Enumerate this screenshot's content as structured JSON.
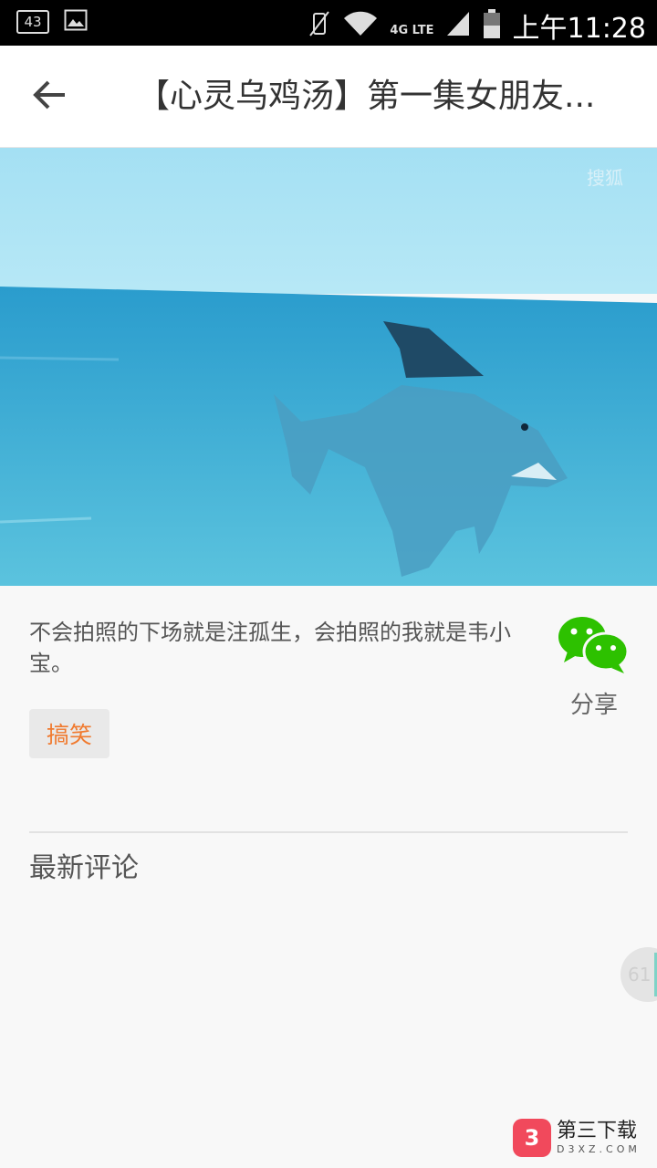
{
  "status_bar": {
    "notification_count": "43",
    "network_label": "4G LTE",
    "time": "上午11:28"
  },
  "header": {
    "title": "【心灵乌鸡汤】第一集女朋友..."
  },
  "video": {
    "watermark": "搜狐"
  },
  "post": {
    "description": "不会拍照的下场就是注孤生，会拍照的我就是韦小宝。",
    "tag": "搞笑",
    "share_label": "分享"
  },
  "comments": {
    "section_title": "最新评论"
  },
  "floating_badge": {
    "value": "61"
  },
  "site_watermark": {
    "logo_glyph": "3",
    "name": "第三下载",
    "domain": "D3XZ.COM"
  },
  "colors": {
    "tag_text": "#f07a2f",
    "wechat_green": "#2dc100",
    "sky": "#9adbf0",
    "sea": "#2e9fd0"
  },
  "icons": {
    "back": "arrow-left-icon",
    "share": "wechat-icon",
    "mute": "vibrate-off-icon",
    "wifi": "wifi-icon",
    "signal": "signal-icon",
    "battery": "battery-icon",
    "gallery": "image-icon"
  }
}
